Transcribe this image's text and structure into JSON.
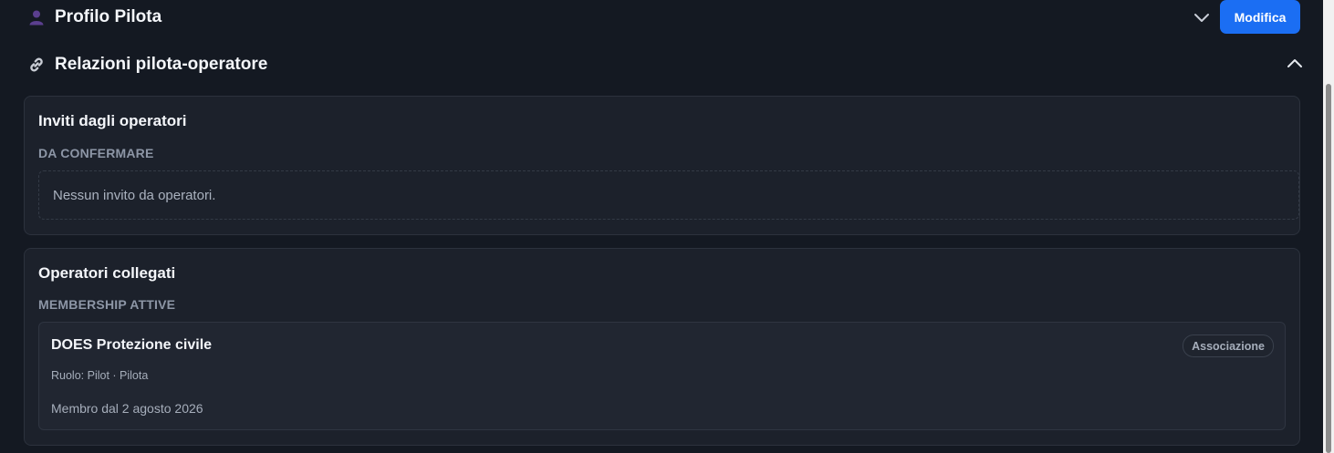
{
  "profile_section": {
    "title": "Profilo Pilota",
    "icon": "user-icon",
    "edit_button": "Modifica"
  },
  "relations_section": {
    "title": "Relazioni pilota-operatore",
    "icon": "link-icon"
  },
  "invites_card": {
    "title": "Inviti dagli operatori",
    "subtitle": "DA CONFERMARE",
    "empty_text": "Nessun invito da operatori."
  },
  "operators_card": {
    "title": "Operatori collegati",
    "subtitle": "MEMBERSHIP ATTIVE",
    "memberships": [
      {
        "name": "DOES Protezione civile",
        "badge": "Associazione",
        "role": "Ruolo: Pilot · Pilota",
        "since": "Membro dal 2 agosto 2026"
      }
    ]
  },
  "colors": {
    "background": "#141922",
    "card": "#1c212b",
    "accent": "#1b6ef3"
  }
}
